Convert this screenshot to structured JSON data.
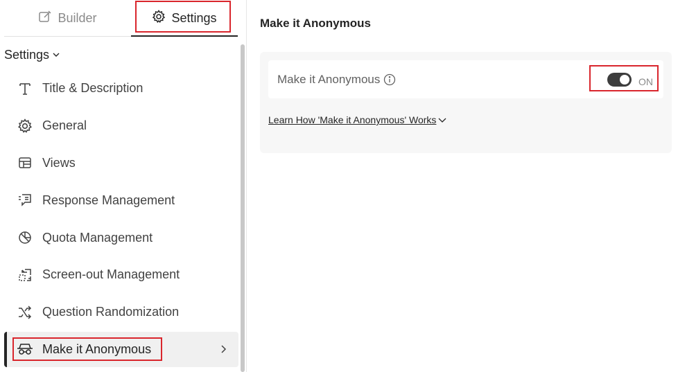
{
  "tabs": {
    "builder_label": "Builder",
    "settings_label": "Settings"
  },
  "sidebar": {
    "header": "Settings",
    "items": [
      {
        "label": "Title & Description",
        "icon": "text-t-icon"
      },
      {
        "label": "General",
        "icon": "gear-icon"
      },
      {
        "label": "Views",
        "icon": "table-layout-icon"
      },
      {
        "label": "Response Management",
        "icon": "chat-list-icon"
      },
      {
        "label": "Quota Management",
        "icon": "quota-icon"
      },
      {
        "label": "Screen-out Management",
        "icon": "screen-out-icon"
      },
      {
        "label": "Question Randomization",
        "icon": "shuffle-icon"
      },
      {
        "label": "Make it Anonymous",
        "icon": "incognito-icon",
        "active": true
      }
    ]
  },
  "main": {
    "title": "Make it Anonymous",
    "setting_label": "Make it Anonymous",
    "toggle_state": "ON",
    "toggle_on": true,
    "learn_link": "Learn How 'Make it Anonymous' Works"
  },
  "colors": {
    "highlight_box": "#d9252c",
    "toggle_on": "#3d3d3d"
  }
}
